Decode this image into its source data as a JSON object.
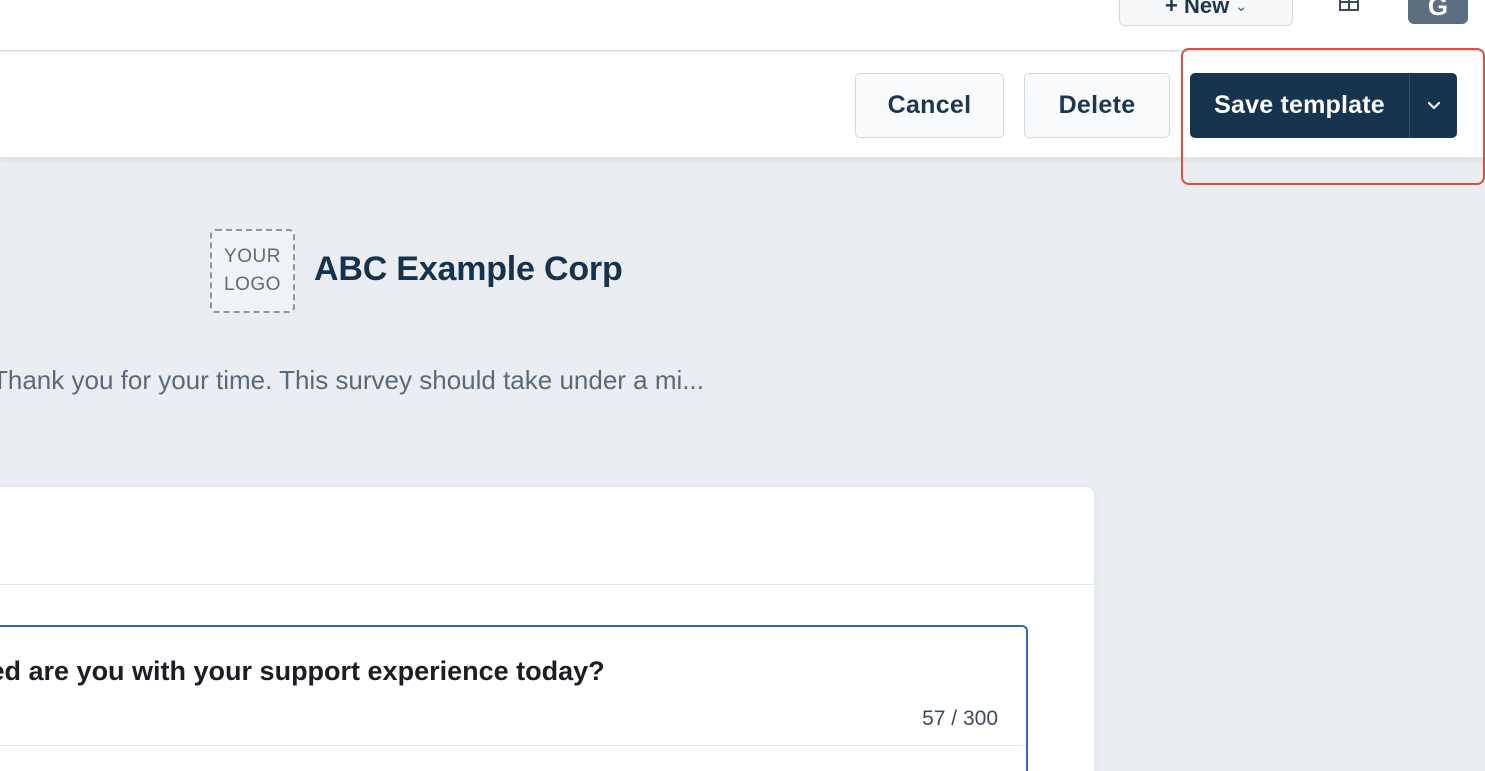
{
  "topbar": {
    "new_label": "+ New",
    "new_caret": "⌄",
    "avatar_initial": "G"
  },
  "actions": {
    "cancel_label": "Cancel",
    "delete_label": "Delete",
    "save_label": "Save template"
  },
  "brand": {
    "logo_line1": "YOUR",
    "logo_line2": "LOGO",
    "company_name": "ABC Example Corp"
  },
  "survey": {
    "intro": "Thank you for your time. This survey should take under a mi...",
    "question_text": "ied are you with your support experience today?",
    "char_count": "57 / 300"
  },
  "colors": {
    "primary": "#163350",
    "highlight": "#d9503f",
    "focus": "#2f64c7",
    "background": "#eaedf1"
  }
}
